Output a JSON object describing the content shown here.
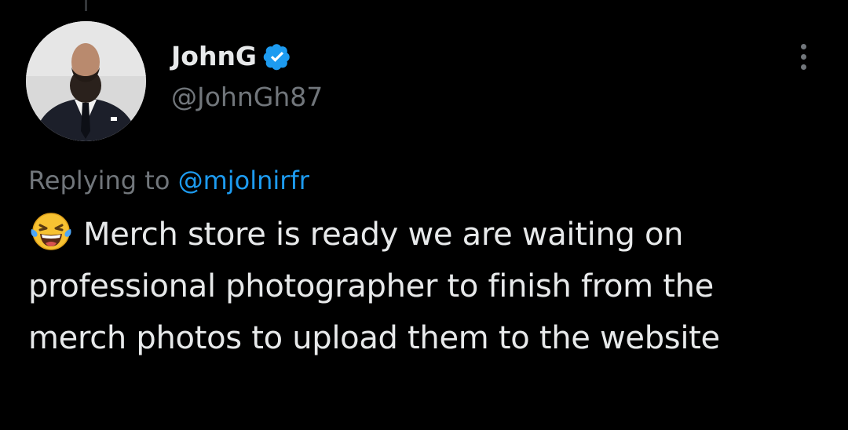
{
  "tweet": {
    "author": {
      "display_name": "JohnG",
      "handle": "@JohnGh87",
      "verified": true
    },
    "replying_prefix": "Replying to",
    "replying_to": "@mjolnirfr",
    "emoji": "face-with-tears-of-joy",
    "text": "Merch store is ready we are waiting on professional photographer to finish from the merch photos to upload them to the website"
  },
  "colors": {
    "background": "#000000",
    "primary_text": "#e7e9ea",
    "secondary_text": "#71767b",
    "accent": "#1d9bf0"
  }
}
